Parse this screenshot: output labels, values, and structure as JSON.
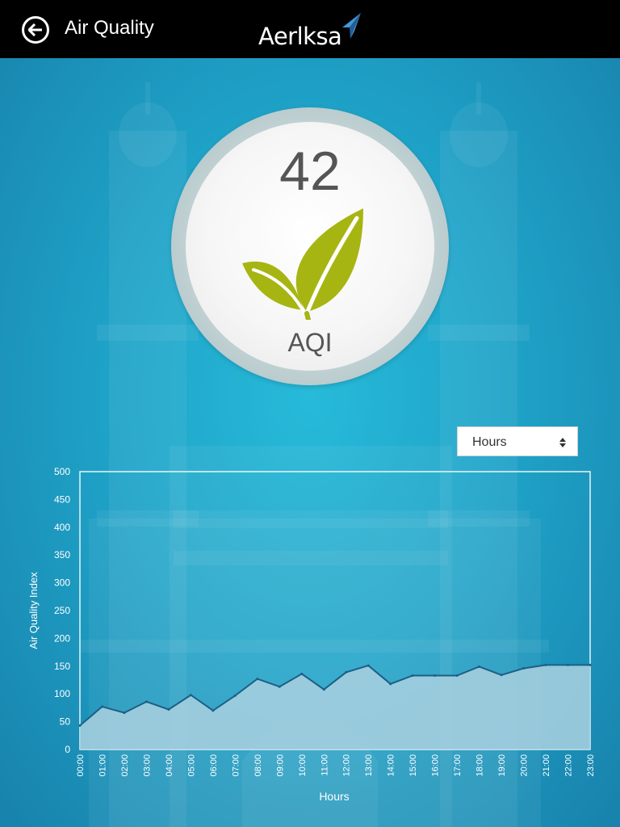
{
  "header": {
    "title": "Air Quality",
    "brand": "Aerlksa",
    "back_icon": "back-arrow-icon"
  },
  "gauge": {
    "value": "42",
    "label": "AQI",
    "icon": "leaf-icon",
    "leaf_color": "#a7b512"
  },
  "range_select": {
    "value": "Hours"
  },
  "chart_data": {
    "type": "area",
    "xlabel": "Hours",
    "ylabel": "Air Quality Index",
    "categories": [
      "00:00",
      "01:00",
      "02:00",
      "03:00",
      "04:00",
      "05:00",
      "06:00",
      "07:00",
      "08:00",
      "09:00",
      "10:00",
      "11:00",
      "12:00",
      "13:00",
      "14:00",
      "15:00",
      "16:00",
      "17:00",
      "18:00",
      "19:00",
      "20:00",
      "21:00",
      "22:00",
      "23:00"
    ],
    "values": [
      43,
      77,
      66,
      86,
      72,
      98,
      70,
      97,
      127,
      113,
      136,
      108,
      139,
      151,
      118,
      133,
      133,
      133,
      149,
      134,
      146,
      152,
      152,
      152
    ],
    "ylim": [
      0,
      500
    ],
    "yticks": [
      "0",
      "50",
      "100",
      "150",
      "200",
      "250",
      "300",
      "350",
      "400",
      "450",
      "500"
    ],
    "grid": false,
    "fill_color": "#a6cfdf",
    "line_color": "#1b5f86"
  }
}
